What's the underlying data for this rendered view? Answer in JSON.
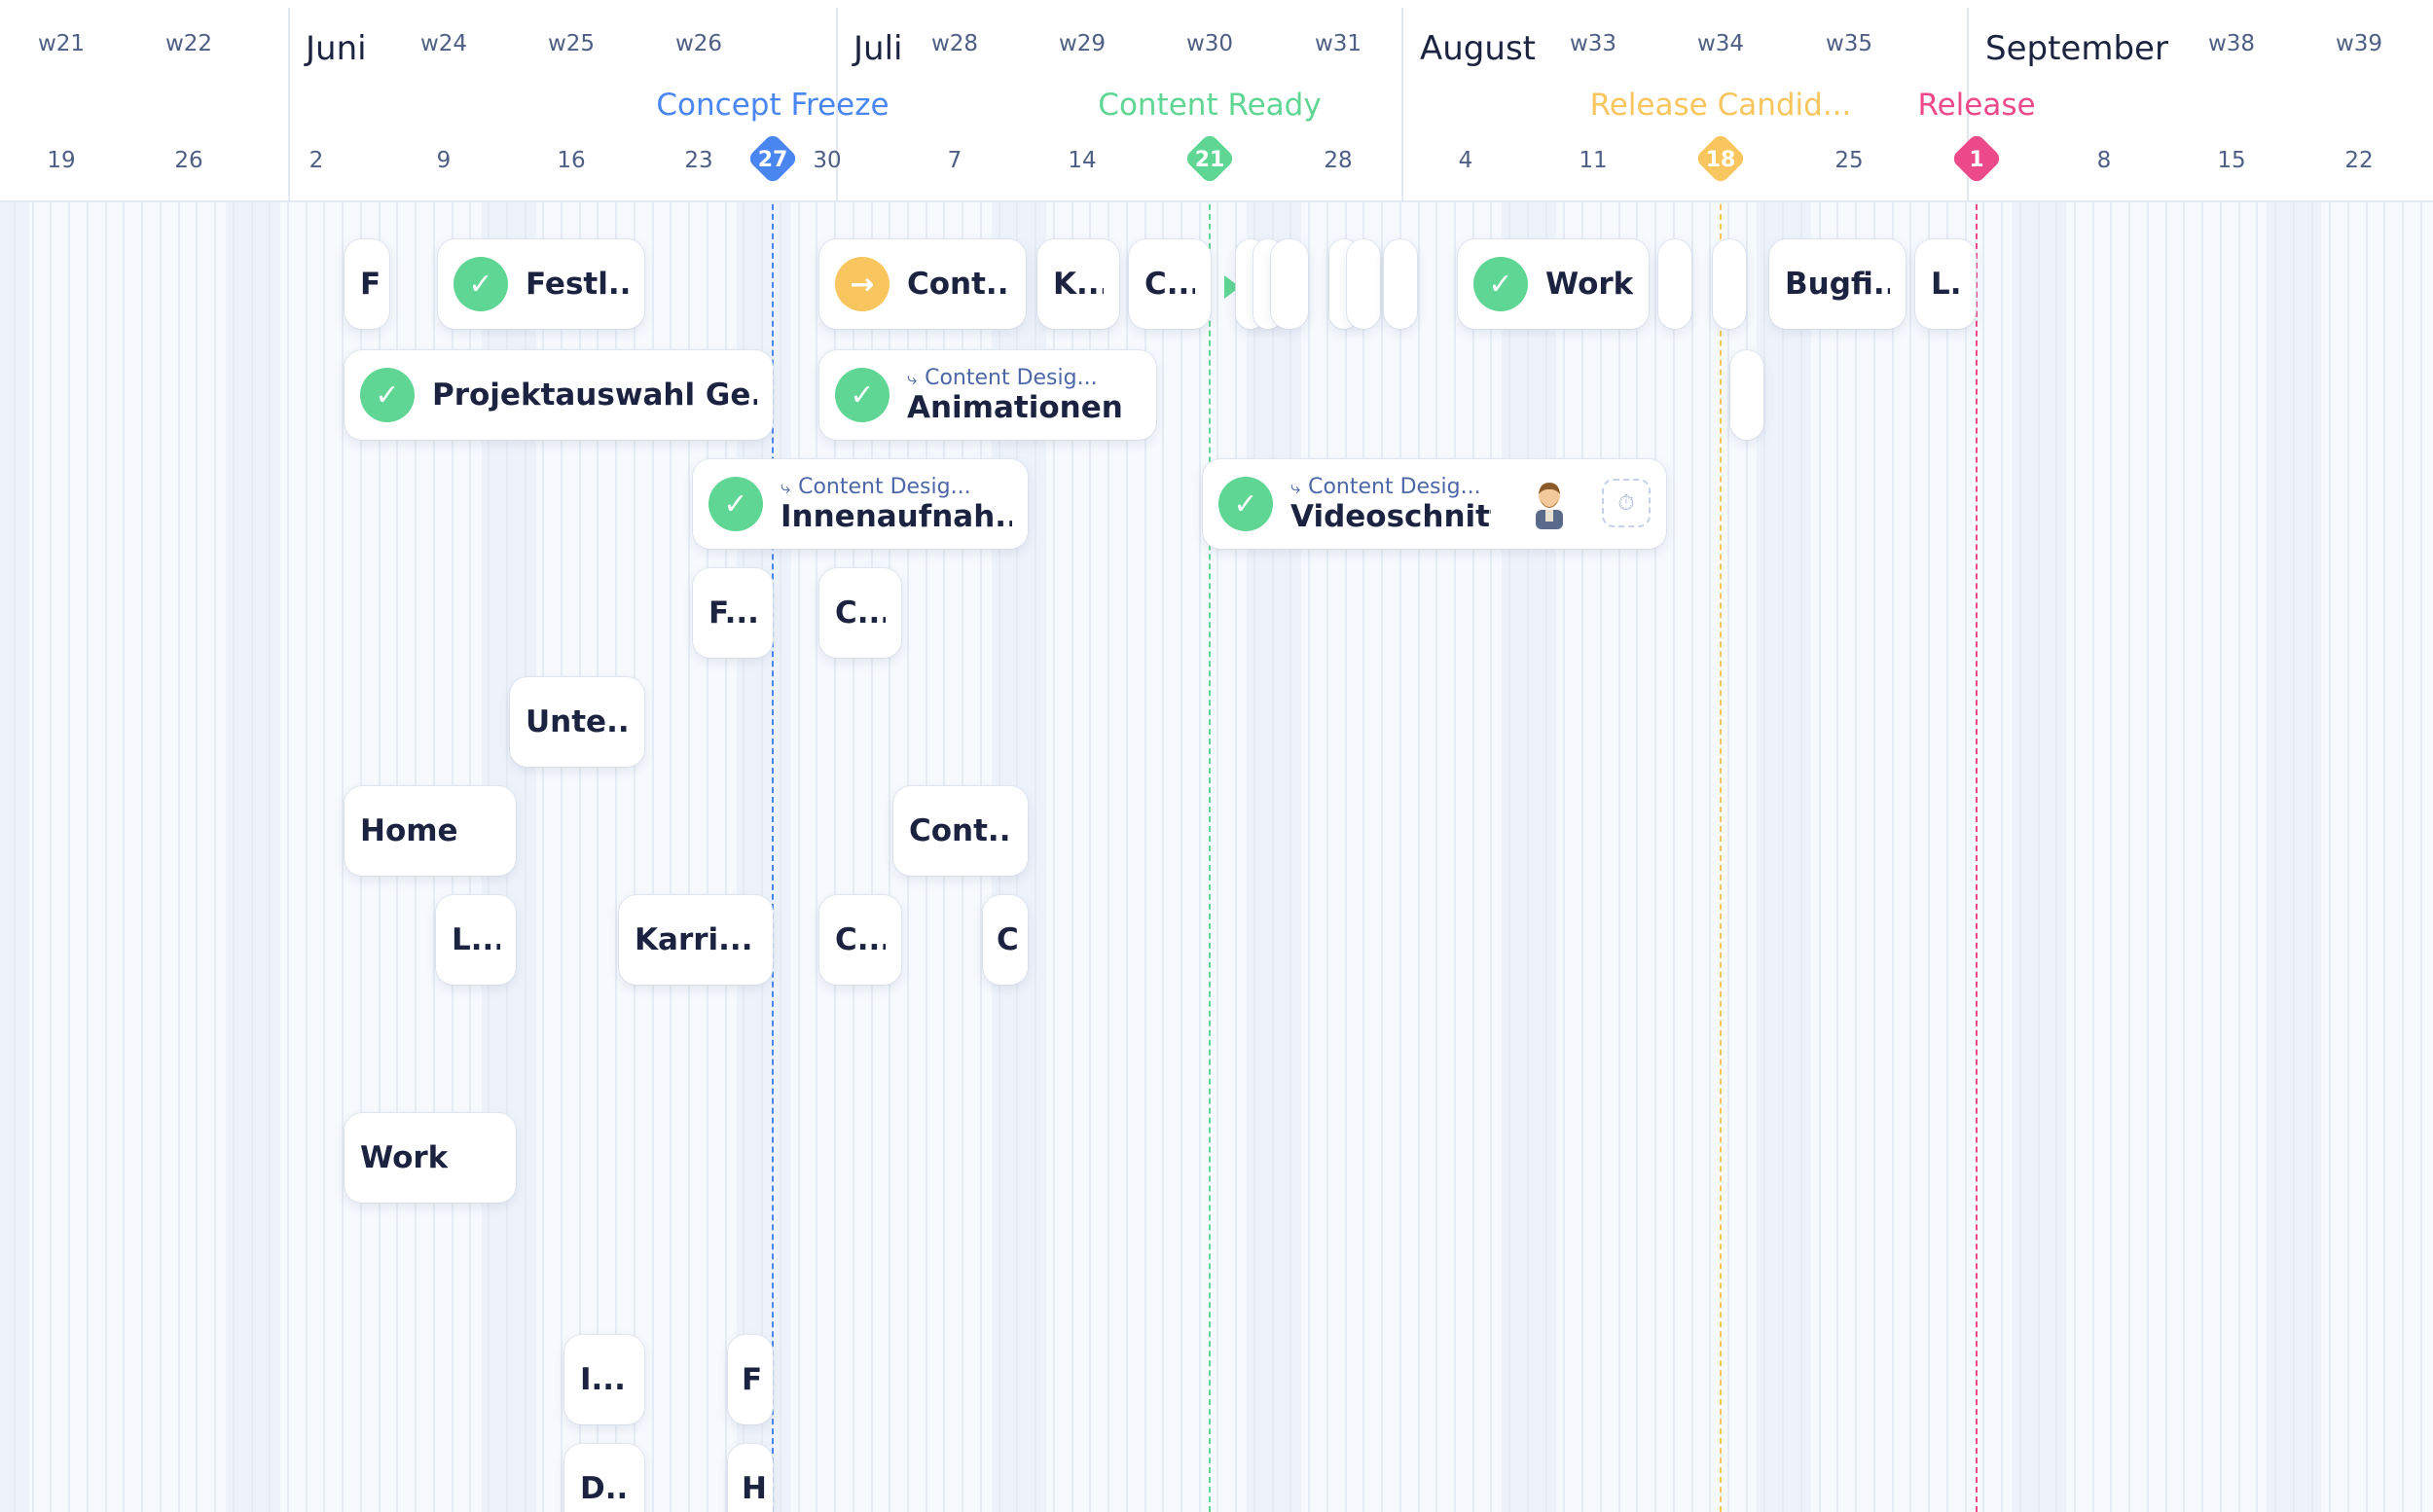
{
  "timeline": {
    "months": [
      {
        "label": "Juni"
      },
      {
        "label": "Juli"
      },
      {
        "label": "August"
      },
      {
        "label": "September"
      }
    ],
    "weeks": [
      "w21",
      "w22",
      "w24",
      "w25",
      "w26",
      "w28",
      "w29",
      "w30",
      "w31",
      "w33",
      "w34",
      "w35",
      "w38",
      "w39"
    ],
    "days": [
      "19",
      "26",
      "2",
      "9",
      "16",
      "23",
      "30",
      "7",
      "14",
      "28",
      "4",
      "11",
      "25",
      "8",
      "15",
      "22"
    ],
    "milestones": [
      {
        "label": "Concept Freeze",
        "day": "27",
        "color": "#4a86f0"
      },
      {
        "label": "Content Ready",
        "day": "21",
        "color": "#5fd693"
      },
      {
        "label": "Release Candid...",
        "day": "18",
        "color": "#f8c55e"
      },
      {
        "label": "Release",
        "day": "1",
        "color": "#ec4a8a"
      }
    ]
  },
  "tasks": {
    "f1": {
      "title": "F"
    },
    "festl": {
      "title": "Festl...",
      "status": "done"
    },
    "cont1": {
      "title": "Cont...",
      "status": "in-progress"
    },
    "k": {
      "title": "K..."
    },
    "c1": {
      "title": "C..."
    },
    "work1": {
      "title": "Work",
      "status": "done"
    },
    "bugfi": {
      "title": "Bugfi..."
    },
    "l1": {
      "title": "L.."
    },
    "projektauswahl": {
      "title": "Projektauswahl Ge...",
      "status": "done"
    },
    "animationen": {
      "title": "Animationen",
      "subtitle": "Content Desig...",
      "status": "done"
    },
    "innenaufnah": {
      "title": "Innenaufnah...",
      "subtitle": "Content Desig...",
      "status": "done"
    },
    "videoschnitt": {
      "title": "Videoschnitt",
      "subtitle": "Content Desig...",
      "status": "done"
    },
    "f2": {
      "title": "F..."
    },
    "c2": {
      "title": "C..."
    },
    "unte": {
      "title": "Unte..."
    },
    "home": {
      "title": "Home"
    },
    "cont2": {
      "title": "Cont..."
    },
    "l2": {
      "title": "L..."
    },
    "karri": {
      "title": "Karri..."
    },
    "c3": {
      "title": "C..."
    },
    "c4": {
      "title": "C"
    },
    "work2": {
      "title": "Work"
    },
    "i": {
      "title": "I..."
    },
    "f3": {
      "title": "F"
    },
    "d": {
      "title": "D..."
    },
    "h": {
      "title": "H"
    }
  },
  "icons": {
    "check": "check-icon",
    "arrow": "arrow-right-icon",
    "subtask": "subtask-icon",
    "avatar": "user-avatar-icon",
    "timer": "timer-icon"
  }
}
